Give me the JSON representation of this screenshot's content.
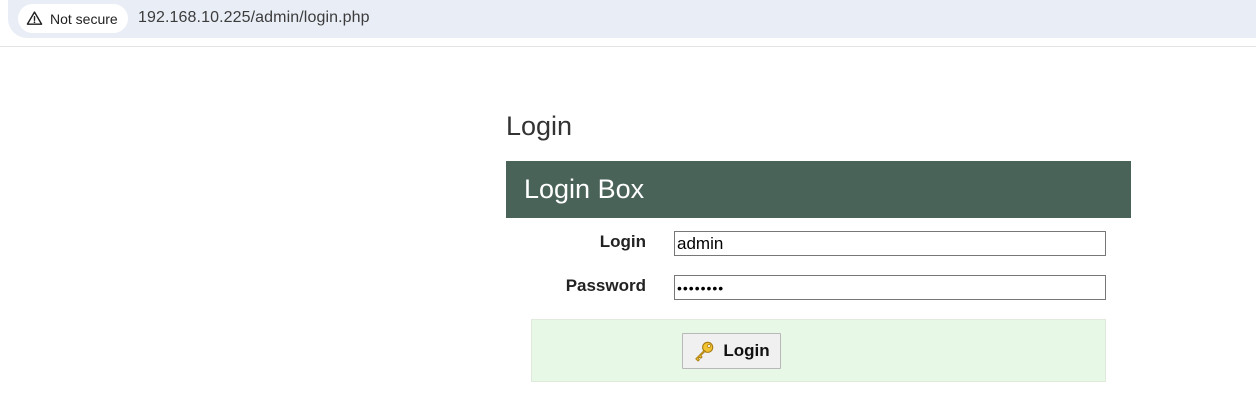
{
  "browser": {
    "security_label": "Not secure",
    "url": "192.168.10.225/admin/login.php"
  },
  "page": {
    "title": "Login"
  },
  "login_box": {
    "header": "Login Box",
    "login_label": "Login",
    "login_value": "admin",
    "password_label": "Password",
    "password_value": "password",
    "submit_label": "Login"
  },
  "colors": {
    "header_bg": "#4a6359",
    "button_row_bg": "#e8f8e6",
    "omnibox_bg": "#e9edf6"
  },
  "icons": {
    "security": "warning-triangle-icon",
    "submit": "key-icon"
  }
}
